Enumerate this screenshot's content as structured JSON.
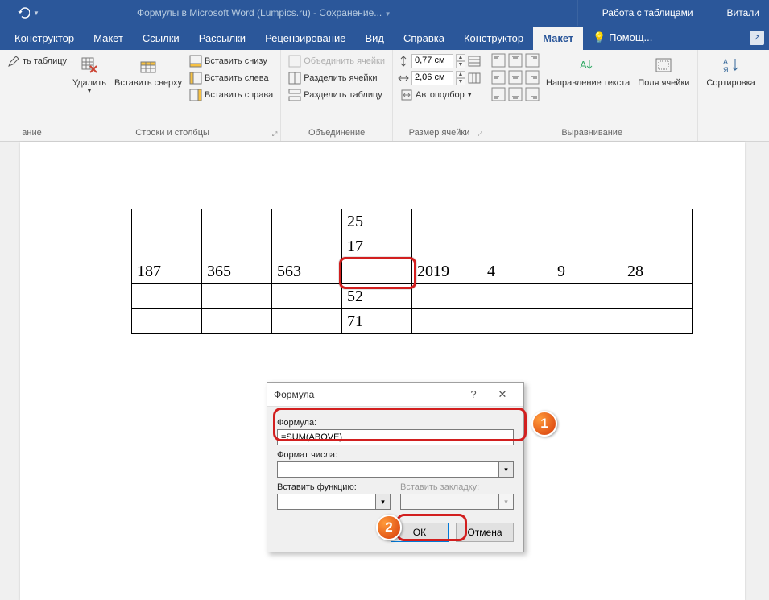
{
  "titlebar": {
    "doc_title": "Формулы в Microsoft Word (Lumpics.ru)  -  Сохранение... ",
    "context_title": "Работа с таблицами",
    "user": "Витали"
  },
  "tabs": {
    "file_hidden": "",
    "constructor": "Конструктор",
    "layout": "Макет",
    "links": "Ссылки",
    "mailings": "Рассылки",
    "review": "Рецензирование",
    "view": "Вид",
    "help": "Справка",
    "table_constructor": "Конструктор",
    "table_layout": "Макет",
    "tell_me": "Помощ..."
  },
  "ribbon": {
    "draw_table_partial": "ть таблицу",
    "group_draw": "ание",
    "delete": "Удалить",
    "insert_above": "Вставить сверху",
    "insert_below": "Вставить снизу",
    "insert_left": "Вставить слева",
    "insert_right": "Вставить справа",
    "group_rows_cols": "Строки и столбцы",
    "merge_cells": "Объединить ячейки",
    "split_cells": "Разделить ячейки",
    "split_table": "Разделить таблицу",
    "group_merge": "Объединение",
    "height_val": "0,77 см",
    "width_val": "2,06 см",
    "autofit": "Автоподбор",
    "group_cell_size": "Размер ячейки",
    "text_direction": "Направление текста",
    "cell_margins": "Поля ячейки",
    "group_alignment": "Выравнивание",
    "sort": "Сортировка"
  },
  "table": {
    "r0": [
      "",
      "",
      "",
      "25",
      "",
      "",
      "",
      ""
    ],
    "r1": [
      "",
      "",
      "",
      "17",
      "",
      "",
      "",
      ""
    ],
    "r2": [
      "187",
      "365",
      "563",
      "",
      "2019",
      "4",
      "9",
      "28"
    ],
    "r3": [
      "",
      "",
      "",
      "52",
      "",
      "",
      "",
      ""
    ],
    "r4": [
      "",
      "",
      "",
      "71",
      "",
      "",
      "",
      ""
    ]
  },
  "dialog": {
    "title": "Формула",
    "formula_label": "Формула:",
    "formula_value": "=SUM(ABOVE)",
    "number_format_label": "Формат числа:",
    "number_format_value": "",
    "insert_function_label": "Вставить функцию:",
    "insert_bookmark_label": "Вставить закладку:",
    "ok": "ОК",
    "cancel": "Отмена"
  },
  "badges": {
    "one": "1",
    "two": "2"
  }
}
